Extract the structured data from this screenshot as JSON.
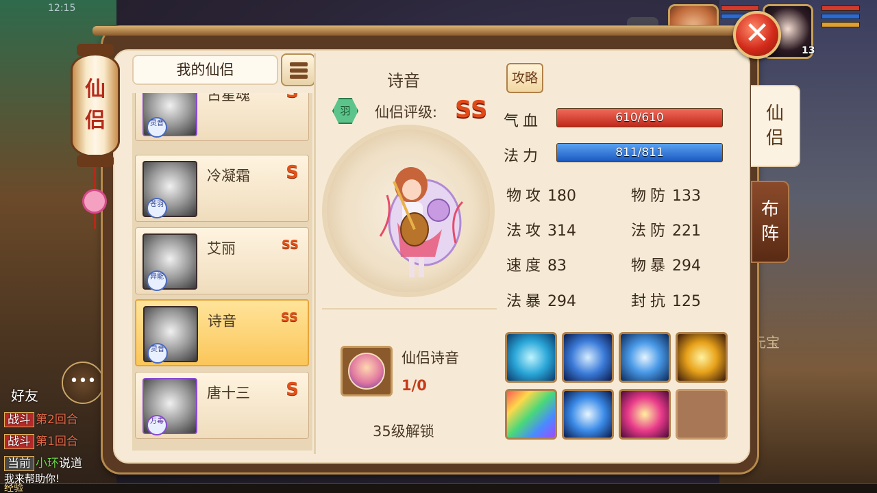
{
  "status_bar": {
    "time": "12:15"
  },
  "hud": {
    "level": "13"
  },
  "lantern": {
    "title": "仙侣"
  },
  "list": {
    "header": "我的仙侣",
    "items": [
      {
        "name": "古星魂",
        "grade": "S",
        "tag": "灵音"
      },
      {
        "name": "冷凝霜",
        "grade": "S",
        "tag": "苍羽"
      },
      {
        "name": "艾丽",
        "grade": "SS",
        "tag": "异能"
      },
      {
        "name": "诗音",
        "grade": "SS",
        "tag": "灵音",
        "selected": true
      },
      {
        "name": "唐十三",
        "grade": "S",
        "tag": "万毒"
      }
    ]
  },
  "detail": {
    "name": "诗音",
    "guide_button": "攻略",
    "rating_label": "仙侣评级:",
    "rating_value": "SS",
    "hex_icon_text": "羽",
    "hp_label": "气血",
    "hp_value": "610/610",
    "mp_label": "法力",
    "mp_value": "811/811",
    "stats": [
      {
        "label": "物攻",
        "value": "180"
      },
      {
        "label": "物防",
        "value": "133"
      },
      {
        "label": "法攻",
        "value": "314"
      },
      {
        "label": "法防",
        "value": "221"
      },
      {
        "label": "速度",
        "value": "83"
      },
      {
        "label": "物暴",
        "value": "294"
      },
      {
        "label": "法暴",
        "value": "294"
      },
      {
        "label": "封抗",
        "value": "125"
      }
    ],
    "skill_name": "仙侣诗音",
    "skill_count": "1/0",
    "unlock_text": "35级解锁"
  },
  "tabs": {
    "active": "仙侣",
    "inactive": "布阵"
  },
  "chat": {
    "friend_label": "好友",
    "lines": [
      {
        "tag": "战斗",
        "text": "第2回合"
      },
      {
        "tag": "战斗",
        "text": "第1回合"
      },
      {
        "tag": "当前",
        "name": "小环",
        "text": "说道"
      }
    ],
    "tail": "我来帮助你!"
  },
  "exp_label": "经验",
  "bg_labels": {
    "yuanbao": "元宝"
  },
  "colors": {
    "panel_bg": "#f6ead6",
    "grade_color": "#e04a18",
    "hp_bar": "#d23a2a",
    "mp_bar": "#2a6ad2",
    "selected_card": "#fbc65a"
  }
}
